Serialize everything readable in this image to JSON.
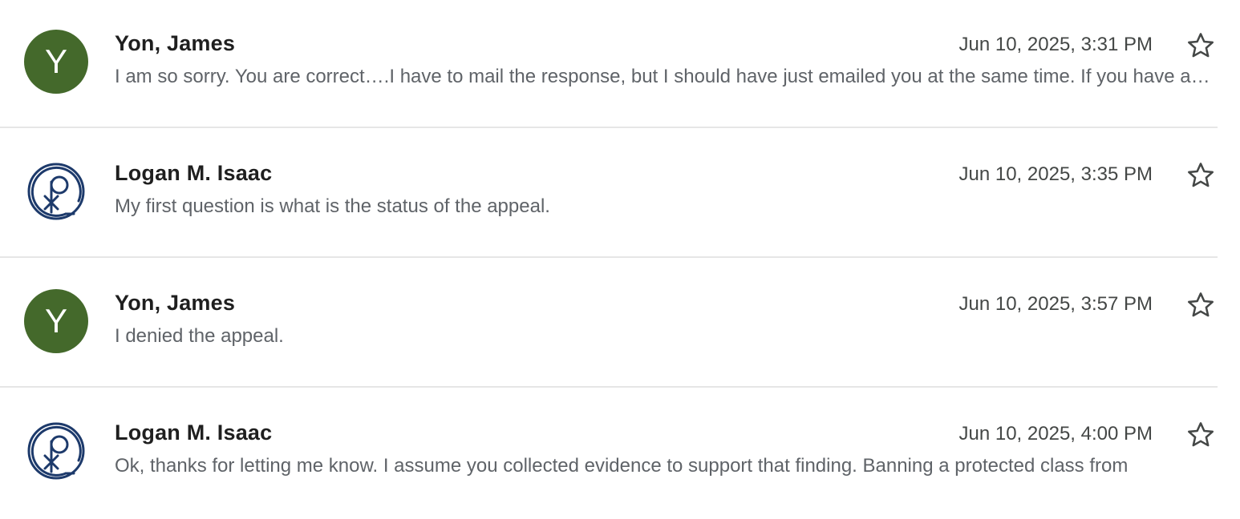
{
  "messages": [
    {
      "sender": "Yon, James",
      "avatar_type": "letter",
      "avatar_letter": "Y",
      "avatar_color": "#44692b",
      "date": "Jun 10, 2025, 3:31 PM",
      "snippet": "I am so sorry. You are correct….I have to mail the response, but I should have just emailed you at the same time. If you have any other questions, please let me know.",
      "starred": false
    },
    {
      "sender": "Logan M. Isaac",
      "avatar_type": "chi-rho-logo",
      "avatar_color": "#1d3a6b",
      "date": "Jun 10, 2025, 3:35 PM",
      "snippet": "My first question is what is the status of the appeal.",
      "starred": false
    },
    {
      "sender": "Yon, James",
      "avatar_type": "letter",
      "avatar_letter": "Y",
      "avatar_color": "#44692b",
      "date": "Jun 10, 2025, 3:57 PM",
      "snippet": "I denied the appeal.",
      "starred": false
    },
    {
      "sender": "Logan M. Isaac",
      "avatar_type": "chi-rho-logo",
      "avatar_color": "#1d3a6b",
      "date": "Jun 10, 2025, 4:00 PM",
      "snippet": "Ok, thanks for letting me know. I assume you collected evidence to support that finding. Banning a protected class from",
      "starred": false
    }
  ],
  "icons": {
    "star": "star-outline-icon",
    "logo": "chi-rho-logo-icon"
  }
}
